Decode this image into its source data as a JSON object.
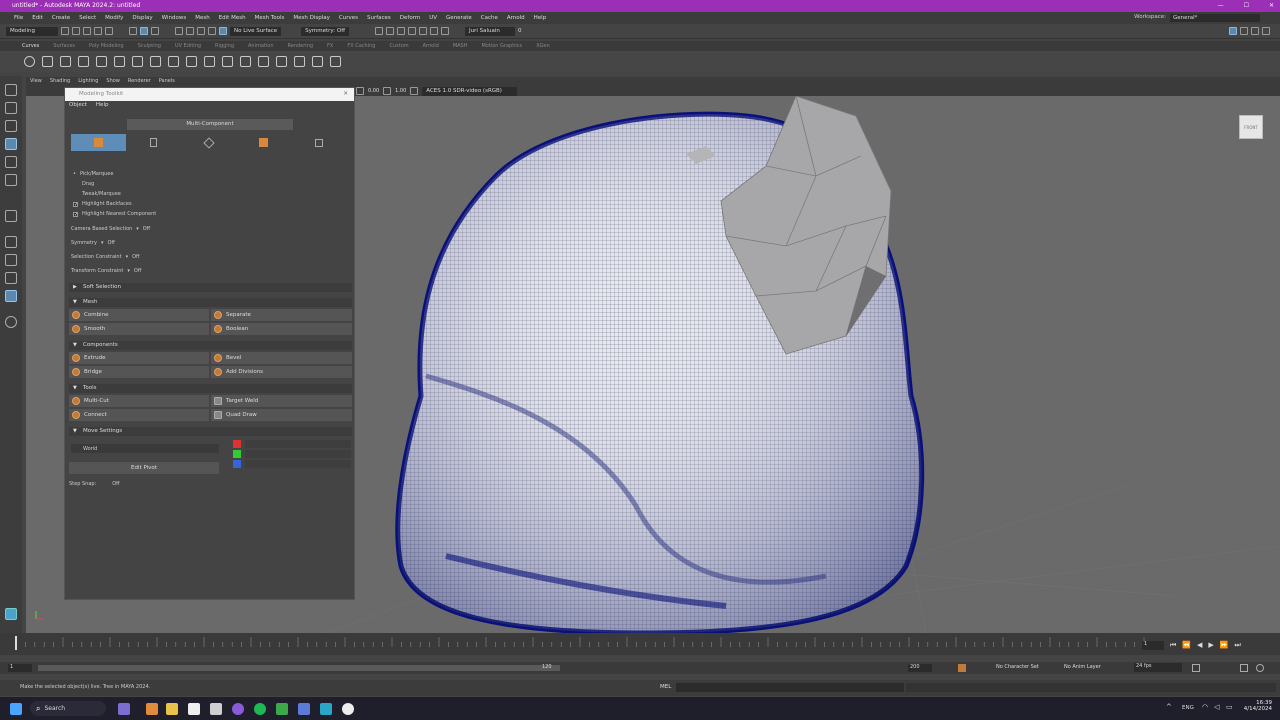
{
  "window": {
    "title": "untitled* - Autodesk MAYA 2024.2: untitled"
  },
  "menubar": {
    "items": [
      "File",
      "Edit",
      "Create",
      "Select",
      "Modify",
      "Display",
      "Windows",
      "Mesh",
      "Edit Mesh",
      "Mesh Tools",
      "Mesh Display",
      "Curves",
      "Surfaces",
      "Deform",
      "UV",
      "Generate",
      "Cache",
      "Arnold",
      "Help"
    ],
    "workspace_label": "Workspace:",
    "workspace_value": "General*"
  },
  "statusline": {
    "mode": "Modeling",
    "live_surface": "No Live Surface",
    "symmetry": "Symmetry: Off",
    "user": "Juri Saluain",
    "notifications": "0"
  },
  "shelf": {
    "tabs": [
      "Curves",
      "Surfaces",
      "Poly Modeling",
      "Sculpting",
      "UV Editing",
      "Rigging",
      "Animation",
      "Rendering",
      "FX",
      "FX Caching",
      "Custom",
      "Arnold",
      "MASH",
      "Motion Graphics",
      "XGen"
    ],
    "active_tab": "Curves"
  },
  "panel": {
    "menus": [
      "View",
      "Shading",
      "Lighting",
      "Show",
      "Renderer",
      "Panels"
    ],
    "exposure": "0.00",
    "gamma": "1.00",
    "colorspace": "ACES 1.0 SDR-video (sRGB)"
  },
  "modeling_toolkit": {
    "title": "Modeling Toolkit",
    "menus": [
      "Object",
      "Help"
    ],
    "mode_label": "Multi-Component",
    "selection_options": [
      {
        "label": "Pick/Marquee",
        "type": "radio",
        "checked": true
      },
      {
        "label": "Drag",
        "type": "radio",
        "checked": false
      },
      {
        "label": "Tweak/Marquee",
        "type": "radio",
        "checked": false
      },
      {
        "label": "Highlight Backfaces",
        "type": "checkbox",
        "checked": true
      },
      {
        "label": "Highlight Nearest Component",
        "type": "checkbox",
        "checked": true
      }
    ],
    "settings": [
      {
        "label": "Camera Based Selection",
        "value": "Off"
      },
      {
        "label": "Symmetry",
        "value": "Off"
      },
      {
        "label": "Selection Constraint",
        "value": "Off"
      },
      {
        "label": "Transform Constraint",
        "value": "Off"
      }
    ],
    "soft_selection": "Soft Selection",
    "sections": {
      "mesh": {
        "title": "Mesh",
        "buttons": [
          "Combine",
          "Separate",
          "Smooth",
          "Boolean"
        ]
      },
      "components": {
        "title": "Components",
        "buttons": [
          "Extrude",
          "Bevel",
          "Bridge",
          "Add Divisions"
        ]
      },
      "tools": {
        "title": "Tools",
        "buttons": [
          "Multi-Cut",
          "Target Weld",
          "Connect",
          "Quad Draw"
        ]
      },
      "move": {
        "title": "Move Settings",
        "space": "World",
        "edit_pivot": "Edit Pivot",
        "step_snap_label": "Step Snap:",
        "step_snap_value": "Off"
      }
    }
  },
  "timeline": {
    "current_frame": "1",
    "range_start": "1",
    "range_mid": "120",
    "range_end": "200",
    "char_set": "No Character Set",
    "anim_layer": "No Anim Layer",
    "fps": "24 fps"
  },
  "command": {
    "help_line": "Make the selected object(s) live. Tree in MAYA 2024.",
    "mel_label": "MEL"
  },
  "taskbar": {
    "search": "Search",
    "lang": "ENG",
    "time": "16:39",
    "date": "4/14/2024"
  }
}
